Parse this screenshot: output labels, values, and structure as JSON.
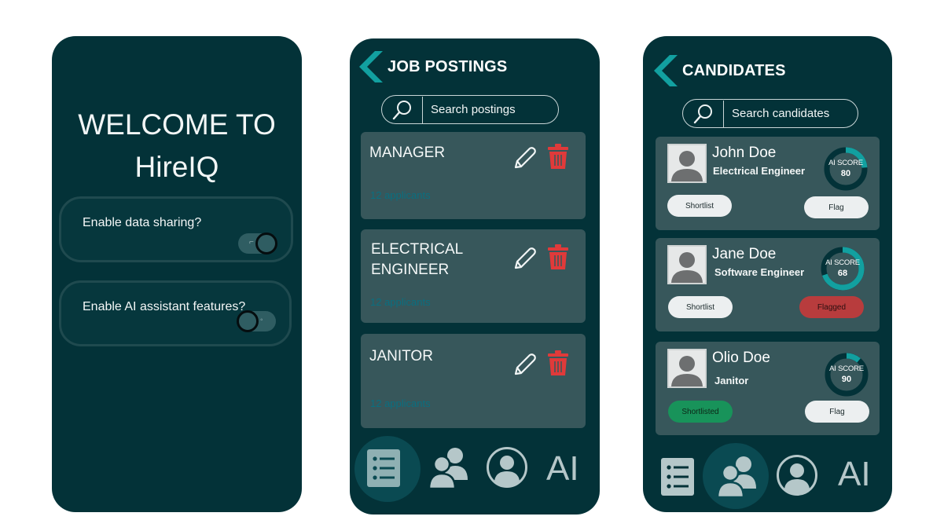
{
  "welcome": {
    "title_line1": "WELCOME TO",
    "title_line2": "HireIQ",
    "settings": [
      {
        "label": "Enable data sharing?",
        "enabled": true
      },
      {
        "label": "Enable AI assistant features?",
        "enabled": false
      }
    ]
  },
  "jobs": {
    "title": "JOB POSTINGS",
    "search_placeholder": "Search postings",
    "postings": [
      {
        "title": "MANAGER",
        "applicants": "12 applicants"
      },
      {
        "title_line1": "ELECTRICAL",
        "title_line2": "ENGINEER",
        "applicants": "12 applicants"
      },
      {
        "title": "JANITOR",
        "applicants": "12 applicants"
      }
    ]
  },
  "candidates": {
    "title": "CANDIDATES",
    "search_placeholder": "Search candidates",
    "score_label": "AI SCORE",
    "list": [
      {
        "name": "John Doe",
        "role": "Electrical Engineer",
        "score": "80",
        "shortlist": "Shortlist",
        "flag": "Flag"
      },
      {
        "name": "Jane Doe",
        "role": "Software Engineer",
        "score": "68",
        "shortlist": "Shortlist",
        "flag": "Flagged"
      },
      {
        "name": "Olio Doe",
        "role": "Janitor",
        "score": "90",
        "shortlist": "Shortlisted",
        "flag": "Flag"
      }
    ]
  },
  "nav": {
    "ai_label": "AI"
  },
  "colors": {
    "background": "#033238",
    "card": "#37575b",
    "accent": "#12a0a0",
    "delete": "#e03a3a",
    "flagged": "#b83c3d",
    "shortlisted": "#18935a"
  }
}
